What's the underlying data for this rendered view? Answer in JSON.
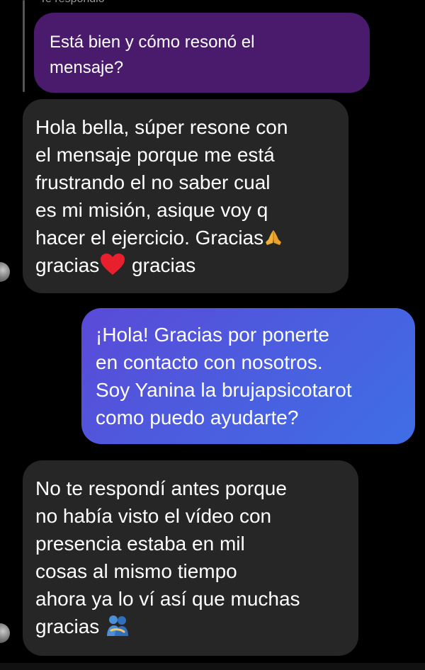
{
  "reply_header": "Te respondió",
  "quoted_message": {
    "text": "Está bien y cómo resonó el\nmensaje?",
    "color": "#4a1a6c"
  },
  "messages": [
    {
      "side": "incoming",
      "lines": [
        "Hola bella, súper resone con",
        "el mensaje porque me está",
        "frustrando el no saber cual",
        "es mi misión, asique voy q",
        "hacer el ejercicio. Gracias"
      ],
      "last_line_a": "gracias",
      "last_line_b": " gracias",
      "emojis": [
        "folded-hands",
        "red-heart"
      ]
    },
    {
      "side": "outgoing",
      "text": "¡Hola! Gracias por ponerte\nen contacto con nosotros.\nSoy Yanina la brujapsicotarot\ncomo puedo ayudarte?",
      "gradient": [
        "#5a4ad8",
        "#3f6ee6"
      ]
    },
    {
      "side": "incoming",
      "lines": [
        "No te respondí antes porque",
        "no había visto el vídeo con",
        "presencia estaba en mil",
        "cosas al mismo tiempo",
        "ahora ya lo ví así que muchas"
      ],
      "last_line_a": "gracias ",
      "emojis": [
        "people-hugging"
      ]
    }
  ],
  "colors": {
    "background": "#000000",
    "incoming_bubble": "#262626",
    "text": "#ffffff"
  }
}
